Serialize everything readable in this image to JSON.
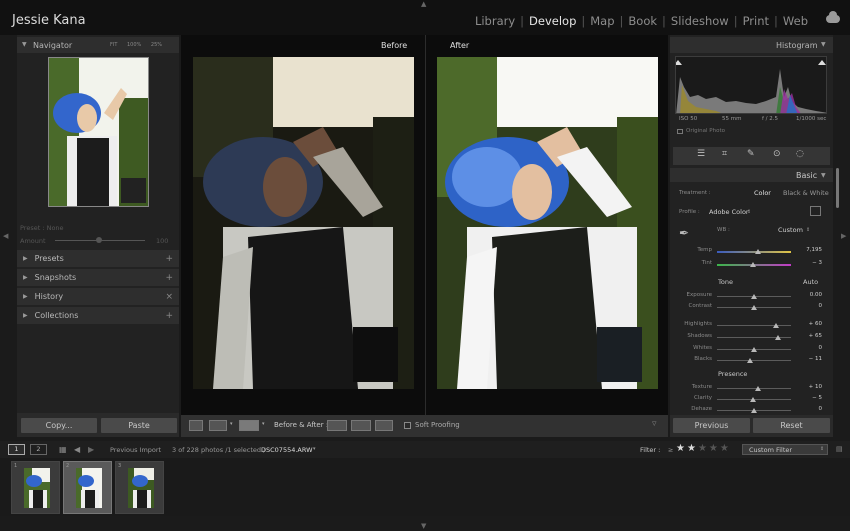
{
  "app_title": "Jessie Kana",
  "modules": [
    "Library",
    "Develop",
    "Map",
    "Book",
    "Slideshow",
    "Print",
    "Web"
  ],
  "active_module": "Develop",
  "navigator": {
    "title": "Navigator",
    "zoom": [
      "FIT",
      "100%",
      "25%"
    ]
  },
  "presets_area": {
    "preset_label": "Preset : None",
    "amount_label": "Amount",
    "amount_value": "100"
  },
  "left_sections": [
    "Presets",
    "Snapshots",
    "History",
    "Collections"
  ],
  "left_buttons": {
    "copy": "Copy...",
    "paste": "Paste"
  },
  "view": {
    "before_label": "Before",
    "after_label": "After"
  },
  "toolbar": {
    "before_after_label": "Before & After :",
    "soft_proofing": "Soft Proofing"
  },
  "histogram": {
    "title": "Histogram",
    "iso": "ISO 50",
    "focal": "55 mm",
    "aperture": "f / 2.5",
    "shutter": "1/1000 sec",
    "original_photo": "Original Photo"
  },
  "basic": {
    "title": "Basic",
    "treatment_label": "Treatment :",
    "treatment_color": "Color",
    "treatment_bw": "Black & White",
    "profile_label": "Profile :",
    "profile_value": "Adobe Color",
    "wb_label": "WB :",
    "wb_value": "Custom",
    "tone_label": "Tone",
    "auto_label": "Auto",
    "presence_label": "Presence",
    "sliders": [
      {
        "name": "temp",
        "label": "Temp",
        "value": "7,195",
        "pos": 0.55
      },
      {
        "name": "tint",
        "label": "Tint",
        "value": "− 3",
        "pos": 0.48
      },
      {
        "name": "exposure",
        "label": "Exposure",
        "value": "0.00",
        "pos": 0.5
      },
      {
        "name": "contrast",
        "label": "Contrast",
        "value": "0",
        "pos": 0.5
      },
      {
        "name": "highlights",
        "label": "Highlights",
        "value": "+ 60",
        "pos": 0.8
      },
      {
        "name": "shadows",
        "label": "Shadows",
        "value": "+ 65",
        "pos": 0.82
      },
      {
        "name": "whites",
        "label": "Whites",
        "value": "0",
        "pos": 0.5
      },
      {
        "name": "blacks",
        "label": "Blacks",
        "value": "− 11",
        "pos": 0.44
      },
      {
        "name": "texture",
        "label": "Texture",
        "value": "+ 10",
        "pos": 0.55
      },
      {
        "name": "clarity",
        "label": "Clarity",
        "value": "− 5",
        "pos": 0.48
      },
      {
        "name": "dehaze",
        "label": "Dehaze",
        "value": "0",
        "pos": 0.5
      }
    ]
  },
  "right_buttons": {
    "previous": "Previous",
    "reset": "Reset"
  },
  "filmbar": {
    "page1": "1",
    "page2": "2",
    "source": "Previous Import",
    "count_text": "3 of 228 photos /1 selected /",
    "filename": "DSC07554.ARW",
    "filter_label": "Filter :",
    "rating_stars": 2,
    "filter_value": "Custom Filter"
  },
  "filmstrip_numbers": [
    "1",
    "2",
    "3"
  ]
}
